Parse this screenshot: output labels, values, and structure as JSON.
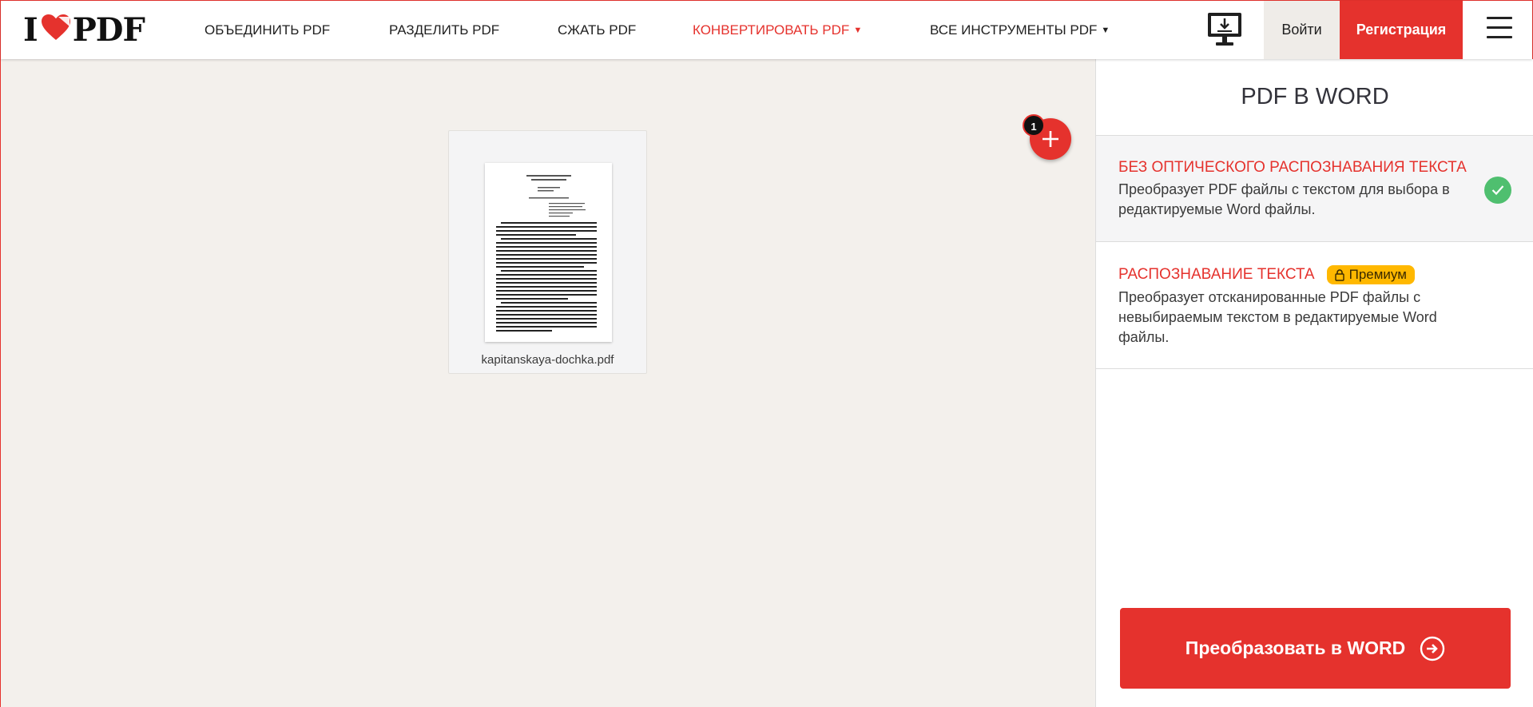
{
  "brand": {
    "logo_left": "I",
    "logo_right": "PDF",
    "accent_color": "#e5322d"
  },
  "nav": {
    "merge": "ОБЪЕДИНИТЬ PDF",
    "split": "РАЗДЕЛИТЬ PDF",
    "compress": "СЖАТЬ PDF",
    "convert": "КОНВЕРТИРОВАТЬ PDF",
    "all_tools": "ВСЕ ИНСТРУМЕНТЫ PDF",
    "login": "Войти",
    "register": "Регистрация"
  },
  "workspace": {
    "file_name": "kapitanskaya-dochka.pdf",
    "file_count": "1"
  },
  "panel": {
    "title": "PDF В WORD",
    "options": [
      {
        "title": "БЕЗ ОПТИЧЕСКОГО РАСПОЗНАВАНИЯ ТЕКСТА",
        "description": "Преобразует PDF файлы с текстом для выбора в редактируемые Word файлы.",
        "selected": true
      },
      {
        "title": "РАСПОЗНАВАНИЕ ТЕКСТА",
        "badge": "Премиум",
        "description": "Преобразует отсканированные PDF файлы с невыбираемым текстом в редактируемые Word файлы.",
        "selected": false
      }
    ],
    "convert_button": "Преобразовать в WORD"
  },
  "icons": {
    "logo_heart": "heart-icon",
    "desktop": "desktop-download-icon",
    "menu": "hamburger-menu-icon",
    "add": "plus-icon",
    "check": "check-circle-icon",
    "lock": "lock-icon",
    "convert": "arrow-right-circle-icon"
  }
}
